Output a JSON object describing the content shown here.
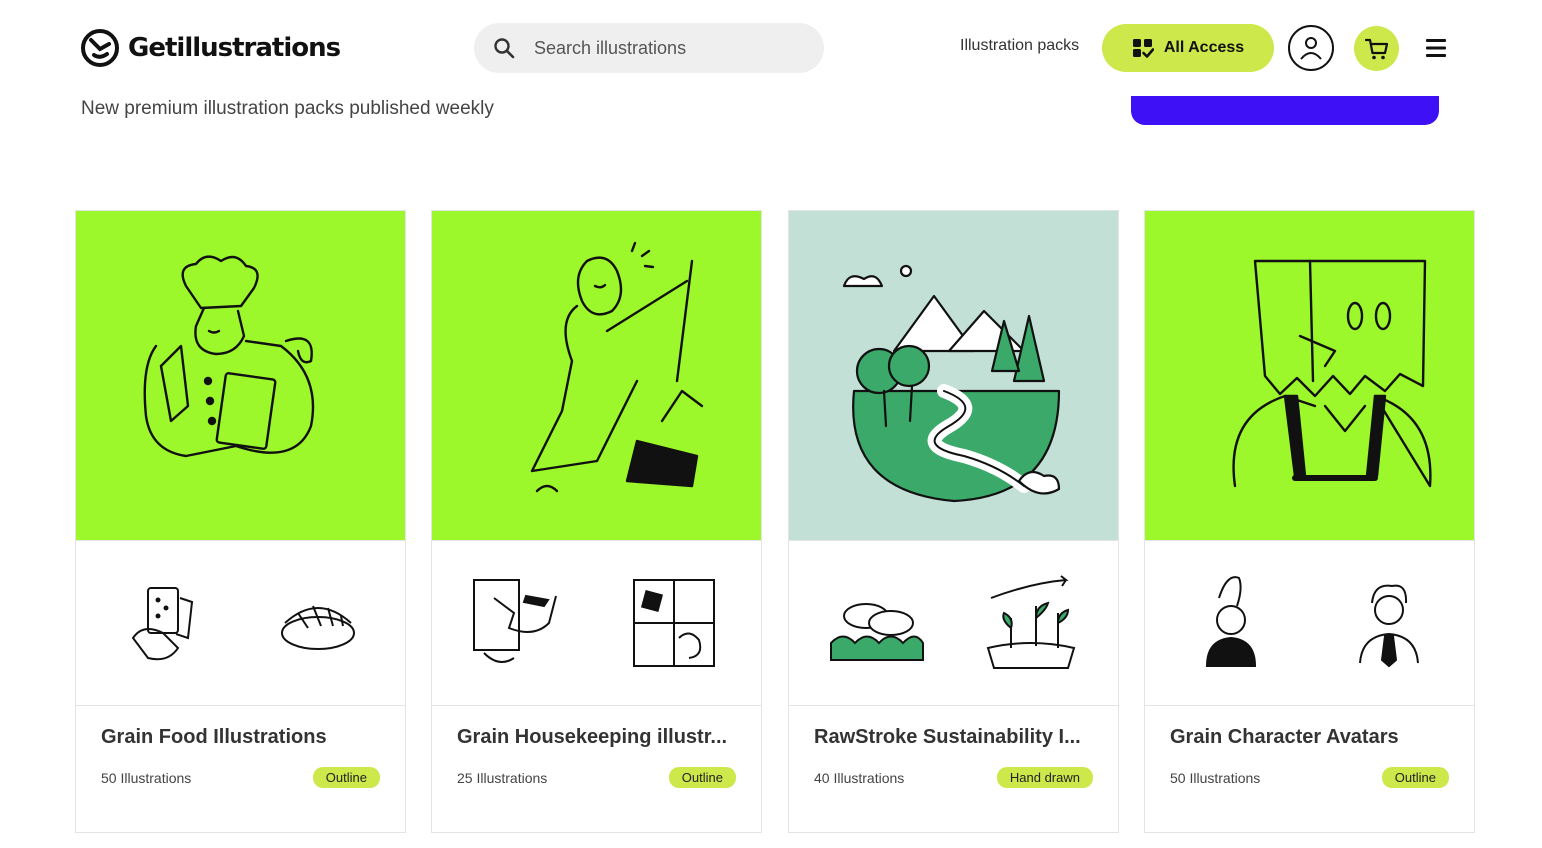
{
  "header": {
    "logo_text": "Getillustrations",
    "search_placeholder": "Search illustrations",
    "nav_link": "Illustration packs",
    "all_access_label": "All Access",
    "icons": {
      "search": "search-icon",
      "grid": "grid-check-icon",
      "account": "user-icon",
      "cart": "cart-icon",
      "menu": "hamburger-icon"
    }
  },
  "subtitle": "New premium illustration packs published weekly",
  "colors": {
    "accent": "#cde84a",
    "brand_blue": "#3d10f5",
    "lime": "#9cf72b",
    "mint": "#c3e0d6",
    "forest": "#3aa96a"
  },
  "cards": [
    {
      "title": "Grain Food Illustrations",
      "count": "50 Illustrations",
      "tag": "Outline",
      "hero_bg": "#9cf72b",
      "hero": "chef-illustration"
    },
    {
      "title": "Grain Housekeeping illustr...",
      "count": "25 Illustrations",
      "tag": "Outline",
      "hero_bg": "#9cf72b",
      "hero": "sweeping-woman-illustration"
    },
    {
      "title": "RawStroke Sustainability I...",
      "count": "40 Illustrations",
      "tag": "Hand drawn",
      "hero_bg": "#c3e0d6",
      "hero": "landscape-river-illustration"
    },
    {
      "title": "Grain Character Avatars",
      "count": "50 Illustrations",
      "tag": "Outline",
      "hero_bg": "#9cf72b",
      "hero": "paper-bag-head-illustration"
    }
  ]
}
